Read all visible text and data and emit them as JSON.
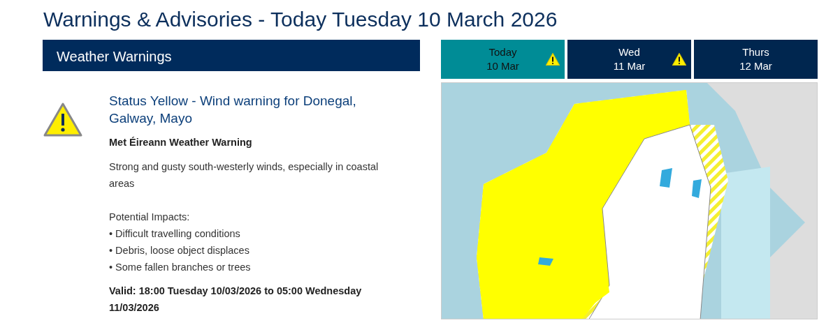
{
  "page_title": "Warnings & Advisories - Today Tuesday 10 March 2026",
  "section": {
    "title": "Weather Warnings"
  },
  "warning": {
    "title": "Status Yellow - Wind warning for Donegal, Galway, Mayo",
    "source": "Met Éireann Weather Warning",
    "description": "Strong and gusty south-westerly winds, especially in coastal areas",
    "impacts_heading": "Potential Impacts:",
    "impacts": [
      "• Difficult travelling conditions",
      "• Debris, loose object displaces",
      "• Some fallen branches or trees"
    ],
    "valid": "Valid: 18:00 Tuesday 10/03/2026 to 05:00 Wednesday 11/03/2026"
  },
  "day_tabs": [
    {
      "day": "Today",
      "date": "10 Mar",
      "selected": true,
      "warning": true
    },
    {
      "day": "Wed",
      "date": "11 Mar",
      "selected": false,
      "warning": true
    },
    {
      "day": "Thurs",
      "date": "12 Mar",
      "selected": false,
      "warning": false
    }
  ]
}
